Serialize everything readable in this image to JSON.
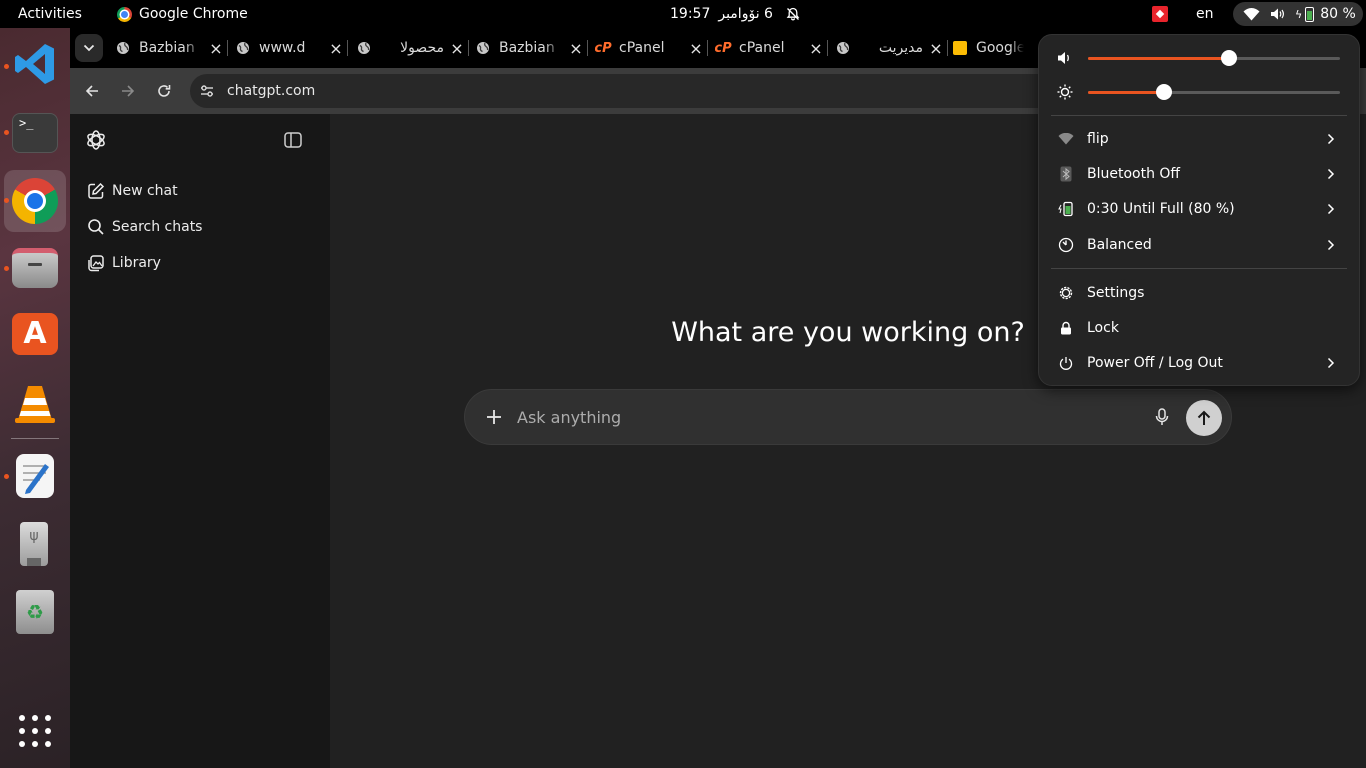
{
  "topbar": {
    "activities": "Activities",
    "app_name": "Google Chrome",
    "time": "19:57",
    "date": "6 نۆوامبر",
    "language": "en",
    "battery": "80 %"
  },
  "dock": {
    "apps": [
      "Visual Studio Code",
      "Terminal",
      "Google Chrome",
      "Files",
      "App Center",
      "VLC",
      "Text Editor",
      "USB Drive",
      "Trash",
      "Show Apps"
    ]
  },
  "tabs": [
    {
      "title": "Bazbian",
      "favicon": "globe-icon",
      "rtl": false
    },
    {
      "title": "www.d",
      "favicon": "globe-icon",
      "rtl": false
    },
    {
      "title": "محصولا",
      "favicon": "globe-icon",
      "rtl": true
    },
    {
      "title": "Bazbian",
      "favicon": "globe-icon",
      "rtl": false
    },
    {
      "title": "cPanel",
      "favicon": "cpanel-icon",
      "rtl": false
    },
    {
      "title": "cPanel",
      "favicon": "cpanel-icon",
      "rtl": false
    },
    {
      "title": "مدیریت",
      "favicon": "globe-icon",
      "rtl": true
    },
    {
      "title": "Google",
      "favicon": "keep-icon",
      "rtl": false
    }
  ],
  "toolbar": {
    "url": "chatgpt.com"
  },
  "sidebar": {
    "items": [
      {
        "label": "New chat",
        "icon": "edit-icon"
      },
      {
        "label": "Search chats",
        "icon": "search-icon"
      },
      {
        "label": "Library",
        "icon": "library-icon"
      }
    ]
  },
  "main": {
    "headline": "What are you working on?",
    "composer_placeholder": "Ask anything"
  },
  "quick_settings": {
    "volume_level": 0.56,
    "brightness_level": 0.3,
    "accent_color": "#e95420",
    "rows": [
      {
        "label": "flip",
        "icon": "wifi-icon",
        "chevron": true
      },
      {
        "label": "Bluetooth Off",
        "icon": "bluetooth-icon",
        "chevron": true
      },
      {
        "label": "0:30 Until Full (80 %)",
        "icon": "battery-icon",
        "chevron": true
      },
      {
        "label": "Balanced",
        "icon": "power-profile-icon",
        "chevron": true
      },
      {
        "label": "Settings",
        "icon": "settings-icon",
        "chevron": false
      },
      {
        "label": "Lock",
        "icon": "lock-icon",
        "chevron": false
      },
      {
        "label": "Power Off / Log Out",
        "icon": "power-icon",
        "chevron": true
      }
    ]
  }
}
